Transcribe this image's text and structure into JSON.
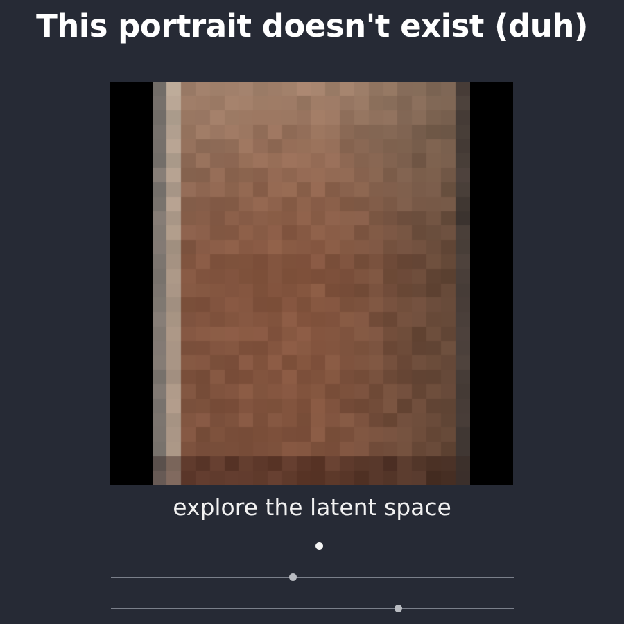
{
  "header": {
    "title": "This portrait doesn't exist (duh)"
  },
  "portrait": {
    "caption": "explore the latent space",
    "icon": "portrait-image"
  },
  "sliders": [
    {
      "name": "latent-slider-1",
      "value": 0.517,
      "active": true
    },
    {
      "name": "latent-slider-2",
      "value": 0.452,
      "active": false
    },
    {
      "name": "latent-slider-3",
      "value": 0.713,
      "active": false
    }
  ],
  "colors": {
    "background": "#262a35",
    "title": "#ffffff",
    "track": "#7a7f8a",
    "thumb": "#b9bcc2",
    "thumb_active": "#f4f4f4"
  }
}
